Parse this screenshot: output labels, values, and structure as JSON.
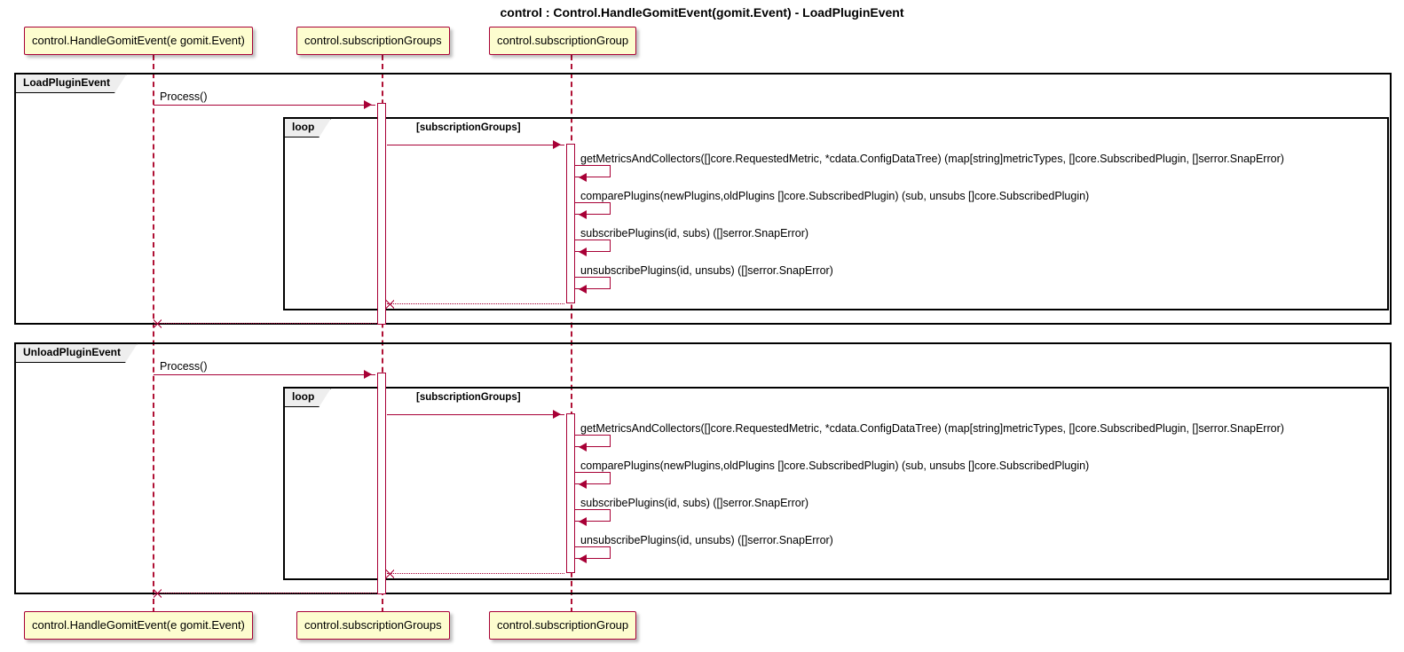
{
  "title": "control : Control.HandleGomitEvent(gomit.Event) - LoadPluginEvent",
  "participants": {
    "p1": "control.HandleGomitEvent(e gomit.Event)",
    "p2": "control.subscriptionGroups",
    "p3": "control.subscriptionGroup"
  },
  "groups": {
    "load": "LoadPluginEvent",
    "unload": "UnloadPluginEvent",
    "loop": "loop",
    "loop_cond": "[subscriptionGroups]"
  },
  "msgs": {
    "process": "Process()",
    "getMetrics": "getMetricsAndCollectors([]core.RequestedMetric, *cdata.ConfigDataTree) (map[string]metricTypes, []core.SubscribedPlugin, []serror.SnapError)",
    "compare": "comparePlugins(newPlugins,oldPlugins []core.SubscribedPlugin) (sub, unsubs []core.SubscribedPlugin)",
    "subscribe": "subscribePlugins(id, subs) ([]serror.SnapError)",
    "unsubscribe": "unsubscribePlugins(id, unsubs) ([]serror.SnapError)"
  },
  "chart_data": {
    "type": "sequence-diagram",
    "title": "control : Control.HandleGomitEvent(gomit.Event) - LoadPluginEvent",
    "participants": [
      "control.HandleGomitEvent(e gomit.Event)",
      "control.subscriptionGroups",
      "control.subscriptionGroup"
    ],
    "fragments": [
      {
        "type": "group",
        "label": "LoadPluginEvent",
        "messages": [
          {
            "from": "control.HandleGomitEvent(e gomit.Event)",
            "to": "control.subscriptionGroups",
            "label": "Process()",
            "kind": "sync"
          },
          {
            "type": "loop",
            "condition": "[subscriptionGroups]",
            "messages": [
              {
                "from": "control.subscriptionGroups",
                "to": "control.subscriptionGroup",
                "label": "",
                "kind": "sync"
              },
              {
                "from": "control.subscriptionGroup",
                "to": "control.subscriptionGroup",
                "label": "getMetricsAndCollectors([]core.RequestedMetric, *cdata.ConfigDataTree) (map[string]metricTypes, []core.SubscribedPlugin, []serror.SnapError)",
                "kind": "self"
              },
              {
                "from": "control.subscriptionGroup",
                "to": "control.subscriptionGroup",
                "label": "comparePlugins(newPlugins,oldPlugins []core.SubscribedPlugin) (sub, unsubs []core.SubscribedPlugin)",
                "kind": "self"
              },
              {
                "from": "control.subscriptionGroup",
                "to": "control.subscriptionGroup",
                "label": "subscribePlugins(id, subs) ([]serror.SnapError)",
                "kind": "self"
              },
              {
                "from": "control.subscriptionGroup",
                "to": "control.subscriptionGroup",
                "label": "unsubscribePlugins(id, unsubs) ([]serror.SnapError)",
                "kind": "self"
              },
              {
                "from": "control.subscriptionGroup",
                "to": "control.subscriptionGroups",
                "label": "",
                "kind": "return"
              }
            ]
          },
          {
            "from": "control.subscriptionGroups",
            "to": "control.HandleGomitEvent(e gomit.Event)",
            "label": "",
            "kind": "return"
          }
        ]
      },
      {
        "type": "group",
        "label": "UnloadPluginEvent",
        "messages": [
          {
            "from": "control.HandleGomitEvent(e gomit.Event)",
            "to": "control.subscriptionGroups",
            "label": "Process()",
            "kind": "sync"
          },
          {
            "type": "loop",
            "condition": "[subscriptionGroups]",
            "messages": [
              {
                "from": "control.subscriptionGroups",
                "to": "control.subscriptionGroup",
                "label": "",
                "kind": "sync"
              },
              {
                "from": "control.subscriptionGroup",
                "to": "control.subscriptionGroup",
                "label": "getMetricsAndCollectors([]core.RequestedMetric, *cdata.ConfigDataTree) (map[string]metricTypes, []core.SubscribedPlugin, []serror.SnapError)",
                "kind": "self"
              },
              {
                "from": "control.subscriptionGroup",
                "to": "control.subscriptionGroup",
                "label": "comparePlugins(newPlugins,oldPlugins []core.SubscribedPlugin) (sub, unsubs []core.SubscribedPlugin)",
                "kind": "self"
              },
              {
                "from": "control.subscriptionGroup",
                "to": "control.subscriptionGroup",
                "label": "subscribePlugins(id, subs) ([]serror.SnapError)",
                "kind": "self"
              },
              {
                "from": "control.subscriptionGroup",
                "to": "control.subscriptionGroup",
                "label": "unsubscribePlugins(id, unsubs) ([]serror.SnapError)",
                "kind": "self"
              },
              {
                "from": "control.subscriptionGroup",
                "to": "control.subscriptionGroups",
                "label": "",
                "kind": "return"
              }
            ]
          },
          {
            "from": "control.subscriptionGroups",
            "to": "control.HandleGomitEvent(e gomit.Event)",
            "label": "",
            "kind": "return"
          }
        ]
      }
    ]
  }
}
